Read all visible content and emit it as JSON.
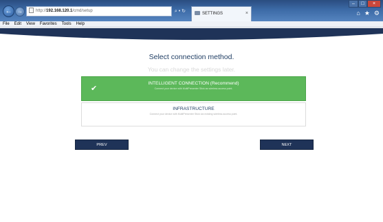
{
  "browser": {
    "address_prefix": "http://",
    "address_host": "192.168.120.1",
    "address_path": "/cmd/setup",
    "address_tools": "⌕ • ↻",
    "tab_title": "SETTINGS",
    "tab_close": "×",
    "nav_back": "←",
    "nav_forward": "→",
    "window_min": "–",
    "window_max": "□",
    "window_close": "×",
    "home_icon": "⌂",
    "favorites_icon": "★",
    "tools_icon": "⚙",
    "menu": [
      "File",
      "Edit",
      "View",
      "Favorites",
      "Tools",
      "Help"
    ]
  },
  "page": {
    "heading": "Select connection method.",
    "subheading": "You can change the settings later.",
    "options": [
      {
        "title": "INTELLIGENT CONNECTION (Recommend)",
        "description": "Connect your device with MultiPresenter Stick as wireless access point.",
        "selected": true
      },
      {
        "title": "INFRASTRUCTURE",
        "description": "Connect your device with MultiPresenter Stick via existing wireless access point.",
        "selected": false
      }
    ],
    "prev_label": "PREV",
    "next_label": "NEXT",
    "check_mark": "✔"
  },
  "colors": {
    "selected_option": "#5cb85a",
    "button": "#1f3358",
    "header_band": "#1f3358",
    "heading_text": "#1f3d63"
  }
}
